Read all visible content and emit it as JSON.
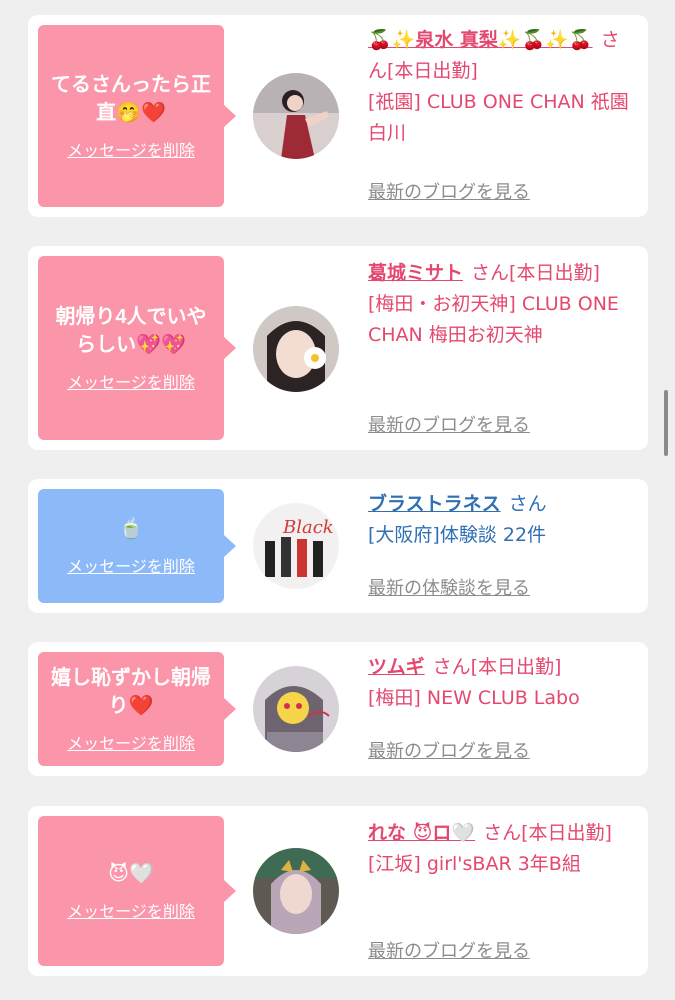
{
  "delete_label": "メッセージを削除",
  "honorific": "さん",
  "cards": [
    {
      "message": "てるさんったら正直🤭❤️",
      "name": "🍒✨泉水 真梨✨🍒✨🍒",
      "status": "[本日出勤]",
      "shop": "[祇園] CLUB ONE CHAN 祇園白川",
      "link": "最新のブログを見る"
    },
    {
      "message": "朝帰り4人でいやらしい💖💖",
      "name": "葛城ミサト",
      "status": "[本日出勤]",
      "shop": "[梅田・お初天神] CLUB ONE CHAN 梅田お初天神",
      "link": "最新のブログを見る"
    },
    {
      "message": "🍵",
      "name": "ブラストラネス",
      "status": "",
      "shop": "[大阪府]体験談 22件",
      "link": "最新の体験談を見る"
    },
    {
      "message": "嬉し恥ずかし朝帰り❤️",
      "name": "ツムギ",
      "status": "[本日出勤]",
      "shop": "[梅田] NEW CLUB Labo",
      "link": "最新のブログを見る"
    },
    {
      "message": "😈🤍",
      "name": "れな 😈ロ🤍",
      "status": "[本日出勤]",
      "shop": "[江坂] girl'sBAR 3年B組",
      "link": "最新のブログを見る"
    }
  ],
  "colors": {
    "pink_bubble": "#fb95aa",
    "blue_bubble": "#8cb9f7",
    "pink_text": "#e5486f",
    "blue_text": "#2f6fb4",
    "link_gray": "#8c8c8c"
  }
}
